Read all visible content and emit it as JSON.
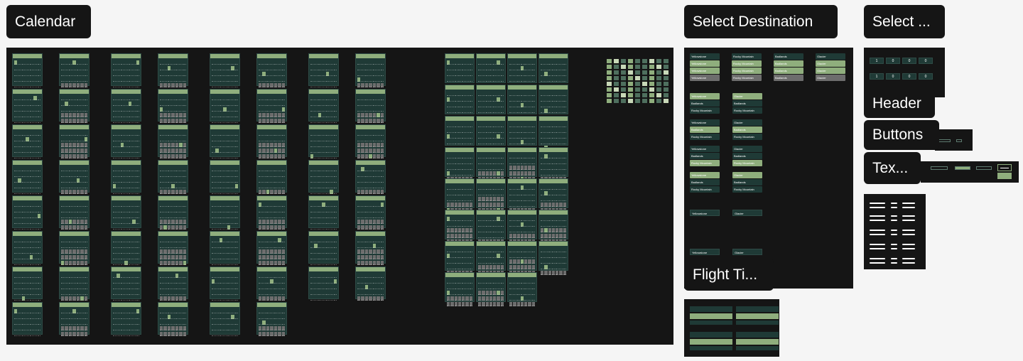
{
  "labels": {
    "calendar": "Calendar",
    "select_destination": "Select Destination",
    "select_ellipsis": "Select ...",
    "header": "Header",
    "buttons": "Buttons",
    "text_ellipsis": "Tex...",
    "flight_times": "Flight Ti..."
  },
  "colors": {
    "canvas": "#151515",
    "card": "#1f3a36",
    "accent": "#8fae7d",
    "disabled": "#6d6d6d",
    "background": "#f5f5f5"
  },
  "destinations": {
    "column_a": [
      "Yellowstone",
      "Yellowstone",
      "Yellowstone",
      "Yellowstone"
    ],
    "column_b": [
      "Rocky Mountain",
      "Rocky Mountain",
      "Rocky Mountain",
      "Rocky Mountain"
    ],
    "column_c": [
      "Badlands",
      "Badlands",
      "Badlands",
      "Badlands"
    ],
    "column_d": [
      "Glacier",
      "Glacier",
      "Glacier",
      "Glacier"
    ],
    "dropdown_left": "Yellowstone",
    "dropdown_right": "Glacier",
    "list_left": [
      "Yellowstone",
      "Badlands",
      "Rocky Mountain"
    ],
    "list_right": [
      "Glacier",
      "Badlands",
      "Rocky Mountain"
    ]
  },
  "counter": {
    "values": [
      "1",
      "0",
      "0",
      "0"
    ]
  }
}
